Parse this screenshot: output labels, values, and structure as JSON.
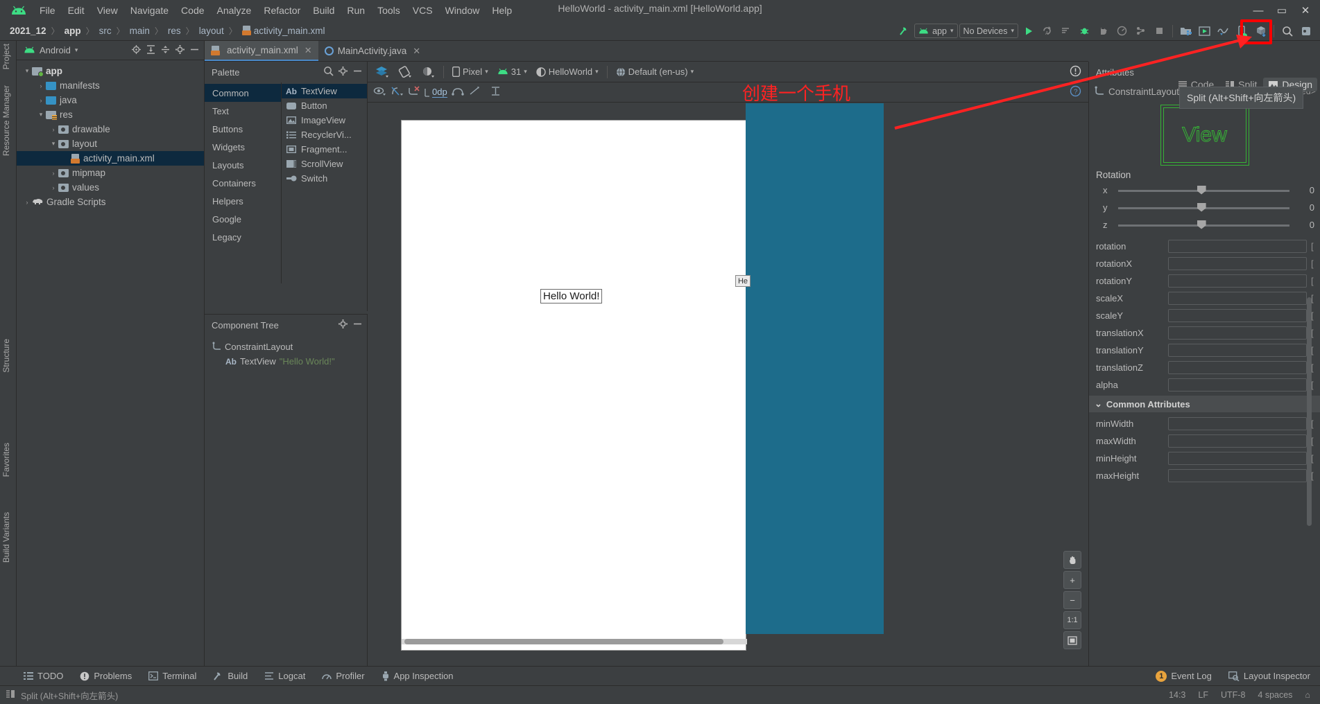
{
  "window": {
    "title": "HelloWorld - activity_main.xml [HelloWorld.app]",
    "minimize": "—",
    "maximize": "▭",
    "close": "✕"
  },
  "menubar": {
    "logo": "android-logo-icon",
    "items": [
      "File",
      "Edit",
      "View",
      "Navigate",
      "Code",
      "Analyze",
      "Refactor",
      "Build",
      "Run",
      "Tools",
      "VCS",
      "Window",
      "Help"
    ]
  },
  "breadcrumb": {
    "items": [
      "2021_12",
      "app",
      "src",
      "main",
      "res",
      "layout",
      "activity_main.xml"
    ],
    "separator": "〉"
  },
  "runbar": {
    "module_label": "app",
    "device_label": "No Devices",
    "dropdown_caret": "▾",
    "icons": [
      "make-project-icon",
      "run-icon",
      "apply-changes-icon",
      "apply-code-changes-icon",
      "debug-icon",
      "attach-debugger-icon",
      "profile-icon",
      "device-file-explorer-icon",
      "stop-icon",
      "sdk-manager-icon",
      "layout-inspector-icon",
      "profiler-icon",
      "avd-manager-icon",
      "gradle-sync-icon",
      "search-everywhere-icon",
      "settings-icon"
    ]
  },
  "left_rail": {
    "top": [
      "Project"
    ],
    "middle": [
      "Resource Manager"
    ],
    "bottom": [
      "Structure",
      "Favorites",
      "Build Variants"
    ]
  },
  "project_panel": {
    "title": "Android",
    "caret": "▾",
    "toolbar_icons": [
      "select-opened-file-icon",
      "expand-all-icon",
      "collapse-all-icon",
      "gear-icon",
      "hide-icon"
    ],
    "tree": [
      {
        "label": "app",
        "depth": 0,
        "arrow": "▾",
        "icon": "folder-module-icon",
        "bold": true,
        "selected": false
      },
      {
        "label": "manifests",
        "depth": 1,
        "arrow": "›",
        "icon": "folder-blue-icon",
        "bold": false,
        "selected": false
      },
      {
        "label": "java",
        "depth": 1,
        "arrow": "›",
        "icon": "folder-blue-icon",
        "bold": false,
        "selected": false
      },
      {
        "label": "res",
        "depth": 1,
        "arrow": "▾",
        "icon": "folder-res-icon",
        "bold": false,
        "selected": false
      },
      {
        "label": "drawable",
        "depth": 2,
        "arrow": "›",
        "icon": "folder-grey-icon",
        "bold": false,
        "selected": false
      },
      {
        "label": "layout",
        "depth": 2,
        "arrow": "▾",
        "icon": "folder-grey-icon",
        "bold": false,
        "selected": false
      },
      {
        "label": "activity_main.xml",
        "depth": 3,
        "arrow": "",
        "icon": "xml-layout-file-icon",
        "bold": false,
        "selected": true
      },
      {
        "label": "mipmap",
        "depth": 2,
        "arrow": "›",
        "icon": "folder-grey-icon",
        "bold": false,
        "selected": false
      },
      {
        "label": "values",
        "depth": 2,
        "arrow": "›",
        "icon": "folder-grey-icon",
        "bold": false,
        "selected": false
      },
      {
        "label": "Gradle Scripts",
        "depth": 0,
        "arrow": "›",
        "icon": "gradle-elephant-icon",
        "bold": false,
        "selected": false
      }
    ]
  },
  "editor_tabs": [
    {
      "label": "activity_main.xml",
      "icon": "xml-layout-file-icon",
      "active": true,
      "close": "✕"
    },
    {
      "label": "MainActivity.java",
      "icon": "java-class-icon",
      "active": false,
      "close": "✕"
    }
  ],
  "view_modes": [
    {
      "label": "Code",
      "icon": "code-view-icon",
      "active": false
    },
    {
      "label": "Split",
      "icon": "split-view-icon",
      "active": false
    },
    {
      "label": "Design",
      "icon": "design-view-icon",
      "active": true
    }
  ],
  "tooltip": {
    "text": "Split (Alt+Shift+向左箭头)"
  },
  "annotation": {
    "text": "创建一个手机",
    "color": "#ff2222"
  },
  "palette": {
    "title": "Palette",
    "toolbar_icons": [
      "search-icon",
      "gear-icon",
      "hide-icon"
    ],
    "categories": [
      {
        "label": "Common",
        "selected": true
      },
      {
        "label": "Text",
        "selected": false
      },
      {
        "label": "Buttons",
        "selected": false
      },
      {
        "label": "Widgets",
        "selected": false
      },
      {
        "label": "Layouts",
        "selected": false
      },
      {
        "label": "Containers",
        "selected": false
      },
      {
        "label": "Helpers",
        "selected": false
      },
      {
        "label": "Google",
        "selected": false
      },
      {
        "label": "Legacy",
        "selected": false
      }
    ],
    "items": [
      {
        "label": "TextView",
        "icon": "ab-textview-icon",
        "selected": true
      },
      {
        "label": "Button",
        "icon": "button-icon",
        "selected": false
      },
      {
        "label": "ImageView",
        "icon": "imageview-icon",
        "selected": false
      },
      {
        "label": "RecyclerVi...",
        "icon": "recyclerview-icon",
        "selected": false
      },
      {
        "label": "Fragment...",
        "icon": "fragment-icon",
        "selected": false
      },
      {
        "label": "ScrollView",
        "icon": "scrollview-icon",
        "selected": false
      },
      {
        "label": "Switch",
        "icon": "switch-icon",
        "selected": false
      }
    ]
  },
  "component_tree": {
    "title": "Component Tree",
    "toolbar_icons": [
      "gear-icon",
      "hide-icon"
    ],
    "rows": [
      {
        "label": "ConstraintLayout",
        "icon": "constraintlayout-icon",
        "value": "",
        "depth": 0
      },
      {
        "label": "TextView",
        "icon": "ab-textview-icon",
        "value": "\"Hello World!\"",
        "depth": 1
      }
    ]
  },
  "design_toolbar": {
    "left_icons": [
      "design-mode-icon",
      "orientation-icon",
      "theme-mode-icon"
    ],
    "device": "Pixel",
    "api_level": "31",
    "theme": "HelloWorld",
    "locale": "Default (en-us)",
    "caret": "▾",
    "warning_icon": "warning-icon"
  },
  "constraint_toolbar": {
    "icons": [
      "show-constraints-icon",
      "autoconnect-off-icon",
      "clear-constraints-icon",
      "infer-constraints-icon",
      "margin-icon",
      "guidelines-icon"
    ],
    "default_margin": "0dp",
    "help_icon": "help-icon"
  },
  "canvas": {
    "hello_world_text": "Hello World!",
    "blueprint_chip": "He",
    "zoom_buttons": [
      {
        "icon": "pan-hand-icon",
        "label": ""
      },
      {
        "icon": "zoom-in-icon",
        "label": "+"
      },
      {
        "icon": "zoom-out-icon",
        "label": "−"
      },
      {
        "icon": "zoom-actual-icon",
        "label": "1:1"
      },
      {
        "icon": "zoom-fit-icon",
        "label": ""
      }
    ]
  },
  "attributes": {
    "title": "Attributes",
    "component": "ConstraintLayout",
    "id_value": "<unnamed>",
    "preview_label": "View",
    "rotation_section": "Rotation",
    "sliders": [
      {
        "label": "x",
        "value": "0"
      },
      {
        "label": "y",
        "value": "0"
      },
      {
        "label": "z",
        "value": "0"
      }
    ],
    "fields": [
      {
        "label": "rotation",
        "value": ""
      },
      {
        "label": "rotationX",
        "value": ""
      },
      {
        "label": "rotationY",
        "value": ""
      },
      {
        "label": "scaleX",
        "value": ""
      },
      {
        "label": "scaleY",
        "value": ""
      },
      {
        "label": "translationX",
        "value": ""
      },
      {
        "label": "translationY",
        "value": ""
      },
      {
        "label": "translationZ",
        "value": ""
      },
      {
        "label": "alpha",
        "value": ""
      }
    ],
    "common_section": {
      "caret": "⌄",
      "label": "Common Attributes"
    },
    "common_fields": [
      {
        "label": "minWidth",
        "value": ""
      },
      {
        "label": "maxWidth",
        "value": ""
      },
      {
        "label": "minHeight",
        "value": ""
      },
      {
        "label": "maxHeight",
        "value": ""
      }
    ]
  },
  "statusbar": {
    "left": [
      {
        "label": "TODO",
        "icon": "todo-icon"
      },
      {
        "label": "Problems",
        "icon": "problems-icon"
      },
      {
        "label": "Terminal",
        "icon": "terminal-icon"
      },
      {
        "label": "Build",
        "icon": "build-hammer-icon"
      },
      {
        "label": "Logcat",
        "icon": "logcat-icon"
      },
      {
        "label": "Profiler",
        "icon": "profiler-icon"
      },
      {
        "label": "App Inspection",
        "icon": "app-inspection-icon"
      }
    ],
    "right": [
      {
        "label": "Event Log",
        "icon": "event-log-icon",
        "badge": "1"
      },
      {
        "label": "Layout Inspector",
        "icon": "layout-inspector-icon",
        "badge": ""
      }
    ]
  },
  "bottombar": {
    "hint_icon": "split-view-icon",
    "hint": "Split (Alt+Shift+向左箭头)",
    "caret": "⌄",
    "right": [
      "14:3",
      "LF",
      "UTF-8",
      "4 spaces",
      "⌂"
    ]
  }
}
